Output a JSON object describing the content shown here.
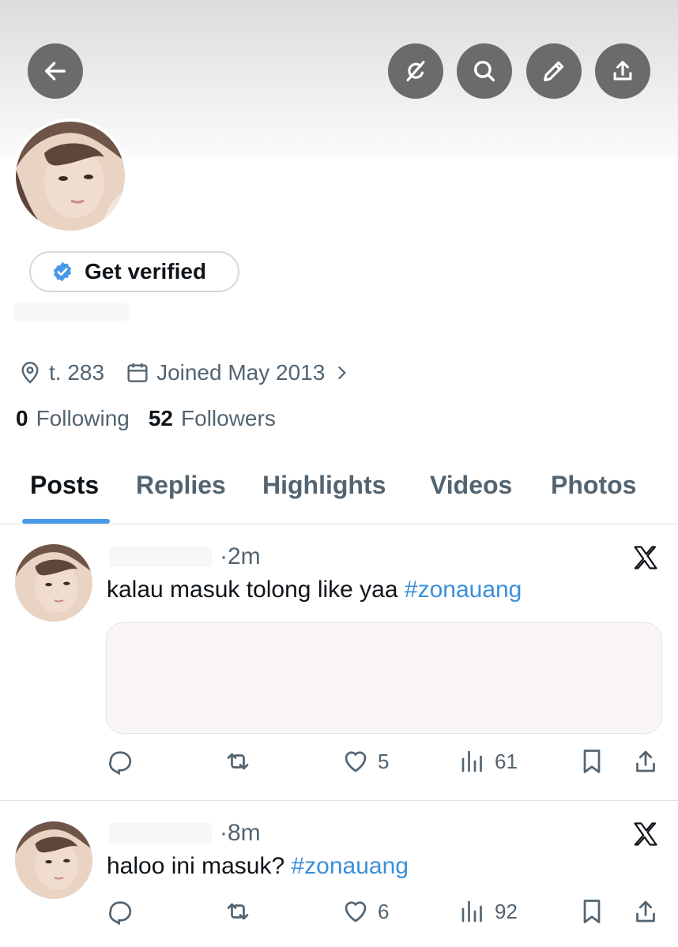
{
  "profile": {
    "verify_label": "Get verified",
    "location": "t. 283",
    "joined": "Joined May 2013",
    "following_count": "0",
    "following_label": "Following",
    "followers_count": "52",
    "followers_label": "Followers"
  },
  "tabs": [
    {
      "label": "Posts",
      "active": true
    },
    {
      "label": "Replies",
      "active": false
    },
    {
      "label": "Highlights",
      "active": false
    },
    {
      "label": "Videos",
      "active": false
    },
    {
      "label": "Photos",
      "active": false
    }
  ],
  "posts": [
    {
      "time": "·2m",
      "text": "kalau masuk tolong like yaa",
      "hashtag": "#zonauang",
      "likes": "5",
      "views": "61"
    },
    {
      "time": "·8m",
      "text": "haloo ini masuk?",
      "hashtag": "#zonauang",
      "likes": "6",
      "views": "92"
    }
  ],
  "colors": {
    "accent": "#4a99e9",
    "hashtag": "#3b8fd9",
    "secondary_text": "#536471",
    "header_button": "#6b6b6b"
  },
  "icons": [
    "back-arrow-icon",
    "grok-icon",
    "search-icon",
    "edit-icon",
    "share-icon",
    "verified-badge-icon",
    "location-icon",
    "calendar-icon",
    "chevron-right-icon",
    "x-logo-icon",
    "reply-icon",
    "repost-icon",
    "like-icon",
    "views-icon",
    "bookmark-icon"
  ]
}
